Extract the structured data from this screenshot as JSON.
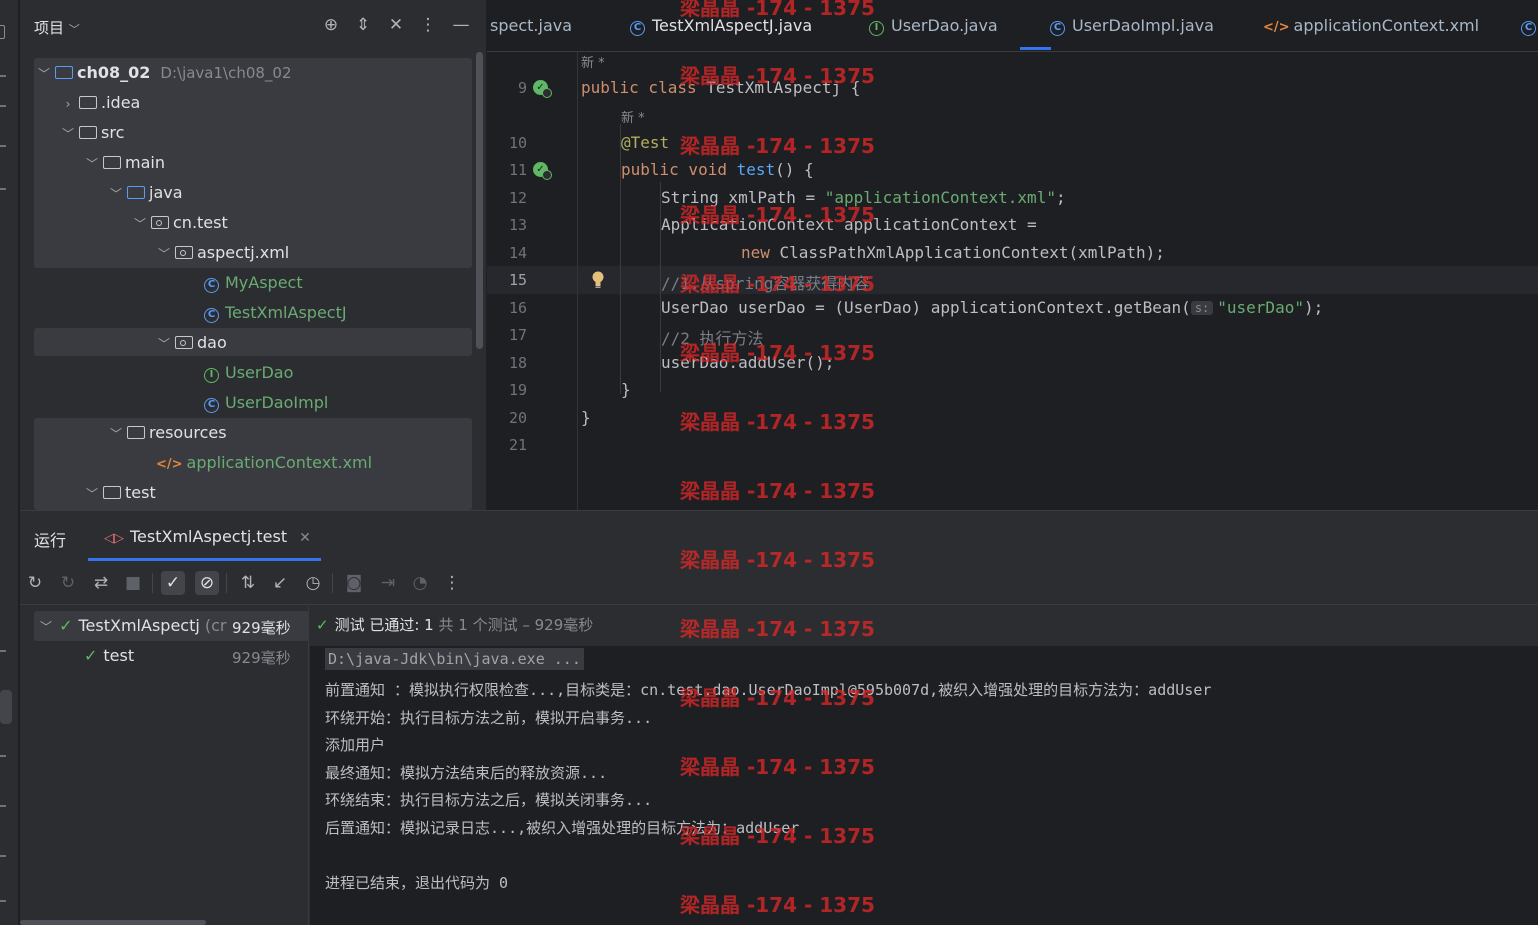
{
  "project_panel": {
    "title": "项目",
    "tree": [
      {
        "label": "ch08_02",
        "path": "D:\\java1\\ch08_02",
        "kind": "module"
      },
      {
        "label": ".idea",
        "kind": "folder"
      },
      {
        "label": "src",
        "kind": "folder"
      },
      {
        "label": "main",
        "kind": "folder"
      },
      {
        "label": "java",
        "kind": "source-folder"
      },
      {
        "label": "cn.test",
        "kind": "package"
      },
      {
        "label": "aspectj.xml",
        "kind": "package"
      },
      {
        "label": "MyAspect",
        "kind": "class"
      },
      {
        "label": "TestXmlAspectJ",
        "kind": "class"
      },
      {
        "label": "dao",
        "kind": "package"
      },
      {
        "label": "UserDao",
        "kind": "interface"
      },
      {
        "label": "UserDaoImpl",
        "kind": "class"
      },
      {
        "label": "resources",
        "kind": "resource-folder"
      },
      {
        "label": "applicationContext.xml",
        "kind": "xml"
      },
      {
        "label": "test",
        "kind": "folder"
      }
    ]
  },
  "editor": {
    "tabs": [
      {
        "label": "spect.java"
      },
      {
        "label": "TestXmlAspectJ.java"
      },
      {
        "label": "UserDao.java"
      },
      {
        "label": "UserDaoImpl.java"
      },
      {
        "label": "applicationContext.xml"
      }
    ],
    "line_numbers": [
      "9",
      "10",
      "11",
      "12",
      "13",
      "14",
      "15",
      "16",
      "17",
      "18",
      "19",
      "20",
      "21"
    ],
    "current_line": "15",
    "hint_new": "新 *",
    "code": {
      "l9_kw": "public class ",
      "l9_name": "TestXmlAspectj {",
      "l10": "@Test",
      "l11_kw": "public void ",
      "l11_fn": "test",
      "l11_rest": "() {",
      "l12_a": "String xmlPath = ",
      "l12_str": "\"applicationContext.xml\"",
      "l12_b": ";",
      "l13": "ApplicationContext applicationContext =",
      "l14_kw": "new ",
      "l14_rest": "ClassPathXmlApplicationContext(xmlPath);",
      "l15": "//1.从spring容器获得内容",
      "l16_a": "UserDao userDao = (UserDao) applicationContext.getBean(",
      "l16_inlay": "s:",
      "l16_str": "\"userDao\"",
      "l16_b": ");",
      "l17": "//2 执行方法",
      "l18": "userDao.addUser();",
      "l19": "}",
      "l20": "}"
    }
  },
  "run_panel": {
    "title": "运行",
    "tab_label": "TestXmlAspectj.test",
    "results": [
      {
        "label": "TestXmlAspectj",
        "suffix": "(cr",
        "time": "929毫秒"
      },
      {
        "label": "test",
        "time": "929毫秒"
      }
    ],
    "status": {
      "passed": "测试 已通过: 1",
      "total": "共 1 个测试 – 929毫秒"
    },
    "console": [
      "D:\\java-Jdk\\bin\\java.exe ...",
      "前置通知 ：模拟执行权限检查...,目标类是：cn.test.dao.UserDaoImpl@595b007d,被织入增强处理的目标方法为：addUser",
      "环绕开始：执行目标方法之前，模拟开启事务...",
      "添加用户",
      "最终通知：模拟方法结束后的释放资源...",
      "环绕结束：执行目标方法之后，模拟关闭事务...",
      "后置通知：模拟记录日志...,被织入增强处理的目标方法为：addUser",
      "",
      "进程已结束，退出代码为 0"
    ]
  },
  "watermark": "梁晶晶 -174 - 1375",
  "colors": {
    "accent": "#3574f0",
    "pass": "#5fb865",
    "watermark": "#dc2828"
  }
}
